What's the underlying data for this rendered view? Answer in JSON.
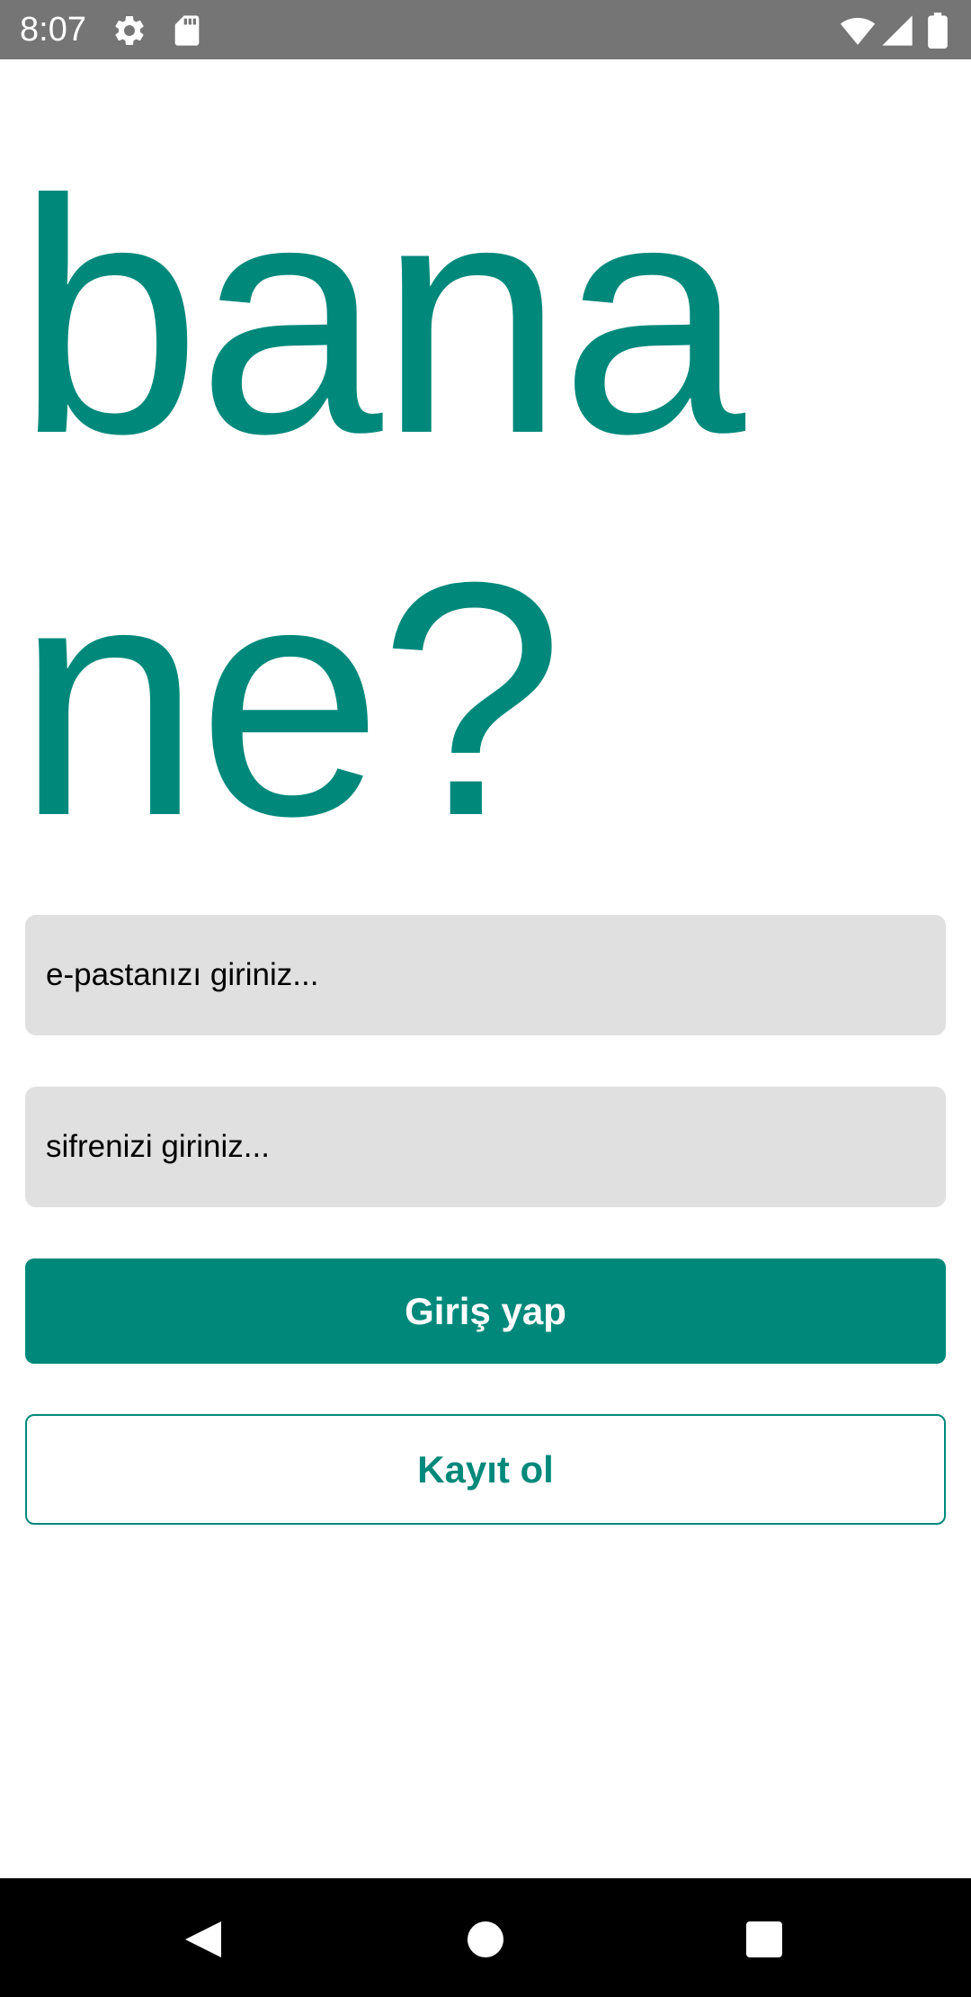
{
  "status_bar": {
    "time": "8:07",
    "icons": [
      "settings-icon",
      "sd-card-icon",
      "wifi-icon",
      "signal-icon",
      "battery-icon"
    ]
  },
  "title": {
    "line1": "bana",
    "line2": "ne?"
  },
  "form": {
    "email_placeholder": "e-pastanızı giriniz...",
    "password_placeholder": "sifrenizi giriniz...",
    "login_label": "Giriş yap",
    "register_label": "Kayıt ol"
  },
  "navigation": {
    "icons": [
      "back-icon",
      "home-icon",
      "recents-icon"
    ]
  },
  "colors": {
    "accent": "#00897b",
    "status_bar": "#757575",
    "input_background": "#e0e0e0",
    "nav_bar": "#000000"
  }
}
